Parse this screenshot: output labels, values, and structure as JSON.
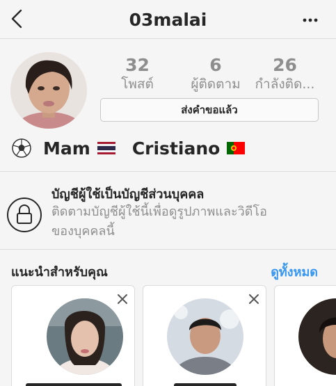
{
  "header": {
    "back_icon": "chevron-left-icon",
    "title": "03malai",
    "more_icon": "more-horizontal-icon"
  },
  "profile": {
    "stats": {
      "posts_count": "32",
      "posts_label": "โพสต์",
      "followers_count": "6",
      "followers_label": "ผู้ติดตาม",
      "following_count": "26",
      "following_label": "กำลังติด..."
    },
    "request_button": "ส่งคำขอแล้ว",
    "bio": {
      "part1": "Mam",
      "part2": "Cristiano",
      "icons": [
        "soccer-ball-icon",
        "thailand-flag-icon",
        "portugal-flag-icon"
      ]
    }
  },
  "private_account": {
    "icon": "lock-icon",
    "title": "บัญชีผู้ใช้เป็นบัญชีส่วนบุคคล",
    "line1": "ติดตามบัญชีผู้ใช้นี้เพื่อดูรูปภาพและวิดีโอ",
    "line2": "ของบุคคลนี้"
  },
  "suggestions": {
    "title": "แนะนำสำหรับคุณ",
    "see_all": "ดูทั้งหมด",
    "accent_color": "#3897f0"
  }
}
